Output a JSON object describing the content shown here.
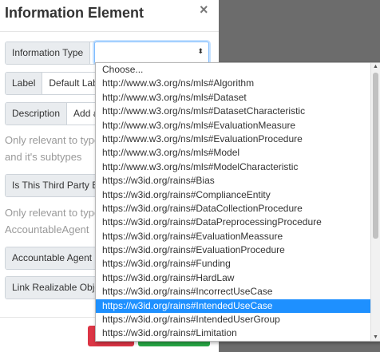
{
  "modal": {
    "title": "Information Element",
    "close_glyph": "×",
    "fields": {
      "information_type_label": "Information Type",
      "select_caret": "⬍",
      "label_label": "Label",
      "label_value": "Default Label",
      "description_label": "Description",
      "description_value": "Add a description",
      "help1_line1": "Only relevant to type",
      "help1_line2": "and it's subtypes",
      "third_party_label": "Is This Third Party E",
      "help2_line1": "Only relevant to type",
      "help2_line2": "AccountableAgent",
      "accountable_agent_label": "Accountable Agent",
      "link_realizable_label": "Link Realizable Object"
    }
  },
  "dropdown": {
    "options": [
      "Choose...",
      "http://www.w3.org/ns/mls#Algorithm",
      "http://www.w3.org/ns/mls#Dataset",
      "http://www.w3.org/ns/mls#DatasetCharacteristic",
      "http://www.w3.org/ns/mls#EvaluationMeasure",
      "http://www.w3.org/ns/mls#EvaluationProcedure",
      "http://www.w3.org/ns/mls#Model",
      "http://www.w3.org/ns/mls#ModelCharacteristic",
      "https://w3id.org/rains#Bias",
      "https://w3id.org/rains#ComplianceEntity",
      "https://w3id.org/rains#DataCollectionProcedure",
      "https://w3id.org/rains#DataPreprocessingProcedure",
      "https://w3id.org/rains#EvaluationMeassure",
      "https://w3id.org/rains#EvaluationProcedure",
      "https://w3id.org/rains#Funding",
      "https://w3id.org/rains#HardLaw",
      "https://w3id.org/rains#IncorrectUseCase",
      "https://w3id.org/rains#IntendedUseCase",
      "https://w3id.org/rains#IntendedUserGroup",
      "https://w3id.org/rains#Limitation"
    ],
    "highlighted": "https://w3id.org/rains#IntendedUseCase",
    "scroll_up_glyph": "▲",
    "scroll_down_glyph": "▼"
  }
}
